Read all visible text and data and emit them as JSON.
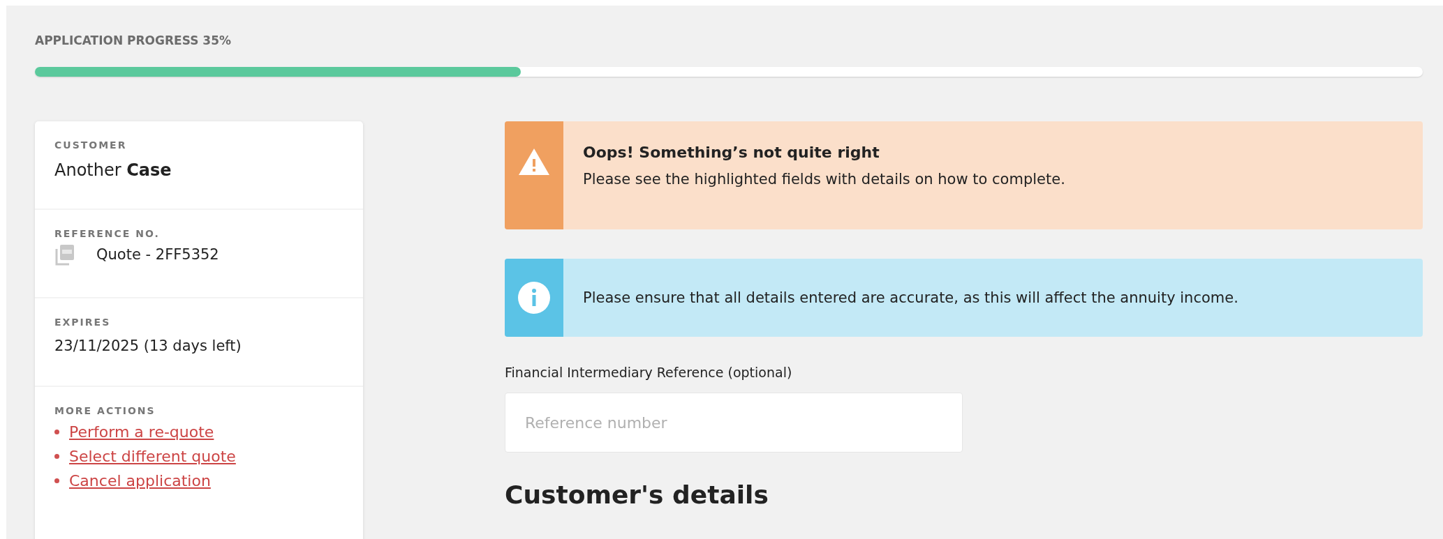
{
  "progress": {
    "label": "APPLICATION PROGRESS 35%",
    "level": 0.35
  },
  "summary": {
    "customer": {
      "label": "CUSTOMER",
      "value": "Another **Case**"
    },
    "reference": {
      "label": "REFERENCE NO.",
      "value": "Quote - 2FF5352"
    },
    "expires": {
      "label": "EXPIRES",
      "value": "23/11/2025 (13 days left)"
    },
    "actions": {
      "label": "MORE ACTIONS",
      "links": [
        "Perform a re-quote",
        "Select different quote",
        "Cancel application"
      ]
    }
  },
  "alerts": [
    {
      "kind": "warning",
      "title": "Oops! Something’s not quite right",
      "text": "Please see the highlighted fields with details on how to complete."
    },
    {
      "kind": "info",
      "text": "Please ensure that all details entered are accurate, as this will affect the annuity income."
    }
  ],
  "field": {
    "label": "Financial Intermediary Reference (optional)",
    "placeholder": "Reference number"
  },
  "heading": "Customer's details"
}
